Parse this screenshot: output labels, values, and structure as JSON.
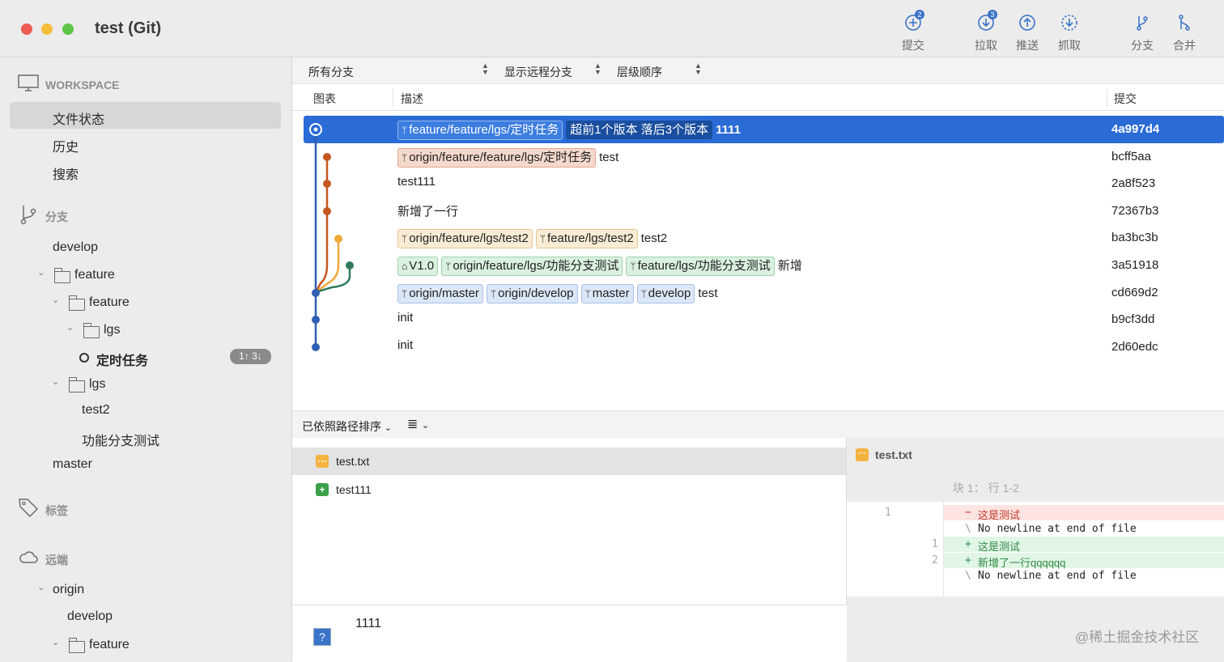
{
  "window": {
    "title": "test (Git)"
  },
  "toolbar": {
    "commit": {
      "label": "提交",
      "badge": "2"
    },
    "pull": {
      "label": "拉取",
      "badge": "3"
    },
    "push": {
      "label": "推送"
    },
    "fetch": {
      "label": "抓取"
    },
    "branch": {
      "label": "分支"
    },
    "merge": {
      "label": "合并"
    }
  },
  "sidebar": {
    "workspace_header": "WORKSPACE",
    "workspace_items": [
      "文件状态",
      "历史",
      "搜索"
    ],
    "branches_header": "分支",
    "branches": {
      "develop": "develop",
      "feature": "feature",
      "feature_feature": "feature",
      "lgs": "lgs",
      "current_branch": "定时任务",
      "current_badge": "1↑ 3↓",
      "lgs2": "lgs",
      "test2": "test2",
      "func_test": "功能分支测试",
      "master": "master"
    },
    "tags_header": "标签",
    "remotes_header": "远端",
    "remotes": {
      "origin": "origin",
      "develop": "develop",
      "feature": "feature"
    }
  },
  "filterbar": {
    "branches": "所有分支",
    "remote": "显示远程分支",
    "order": "层级顺序"
  },
  "columns": {
    "graph": "图表",
    "description": "描述",
    "commit": "提交"
  },
  "commits": [
    {
      "tags": [
        {
          "text": "feature/feature/lgs/定时任务",
          "style": "t-sel",
          "icon": "branch"
        },
        {
          "text": "超前1个版本 落后3个版本",
          "style": "t-ahead",
          "icon": ""
        }
      ],
      "message": "1111",
      "hash": "4a997d4"
    },
    {
      "tags": [
        {
          "text": "origin/feature/feature/lgs/定时任务",
          "style": "t-orange",
          "icon": "branch"
        }
      ],
      "message": "test",
      "hash": "bcff5aa"
    },
    {
      "tags": [],
      "message": "test111",
      "hash": "2a8f523"
    },
    {
      "tags": [],
      "message": "新增了一行",
      "hash": "72367b3"
    },
    {
      "tags": [
        {
          "text": "origin/feature/lgs/test2",
          "style": "t-yellow",
          "icon": "branch"
        },
        {
          "text": "feature/lgs/test2",
          "style": "t-yellow",
          "icon": "branch"
        }
      ],
      "message": "test2",
      "hash": "ba3bc3b"
    },
    {
      "tags": [
        {
          "text": "V1.0",
          "style": "t-green",
          "icon": "tag"
        },
        {
          "text": "origin/feature/lgs/功能分支测试",
          "style": "t-green",
          "icon": "branch"
        },
        {
          "text": "feature/lgs/功能分支测试",
          "style": "t-green",
          "icon": "branch"
        }
      ],
      "message": "新增",
      "hash": "3a51918"
    },
    {
      "tags": [
        {
          "text": "origin/master",
          "style": "t-blue",
          "icon": "branch"
        },
        {
          "text": "origin/develop",
          "style": "t-blue",
          "icon": "branch"
        },
        {
          "text": "master",
          "style": "t-blue",
          "icon": "branch"
        },
        {
          "text": "develop",
          "style": "t-blue",
          "icon": "branch"
        }
      ],
      "message": "test",
      "hash": "cd669d2"
    },
    {
      "tags": [],
      "message": "init",
      "hash": "b9cf3dd"
    },
    {
      "tags": [],
      "message": "init",
      "hash": "2d60edc"
    }
  ],
  "files_panel": {
    "sort_label": "已依照路径排序",
    "files": [
      {
        "name": "test.txt",
        "status": "modified"
      },
      {
        "name": "test111",
        "status": "added"
      }
    ],
    "commit_message": "1111"
  },
  "diff": {
    "file": "test.txt",
    "hunk": "块 1： 行 1-2",
    "lines": [
      {
        "old": "1",
        "new": "",
        "sign": "−",
        "text": "这是测试",
        "type": "del"
      },
      {
        "old": "",
        "new": "",
        "sign": "\\",
        "text": " No newline at end of file",
        "type": "note"
      },
      {
        "old": "",
        "new": "1",
        "sign": "+",
        "text": "这是测试",
        "type": "add"
      },
      {
        "old": "",
        "new": "2",
        "sign": "+",
        "text": "新增了一行qqqqqq",
        "type": "add"
      },
      {
        "old": "",
        "new": "",
        "sign": "\\",
        "text": " No newline at end of file",
        "type": "note"
      }
    ]
  },
  "watermark": "@稀土掘金技术社区",
  "colors": {
    "selection": "#2a6bd6",
    "graph_blue": "#2f5fb4",
    "graph_orange": "#c4571f",
    "graph_yellow": "#efa83a",
    "graph_green": "#2f7a5a"
  }
}
